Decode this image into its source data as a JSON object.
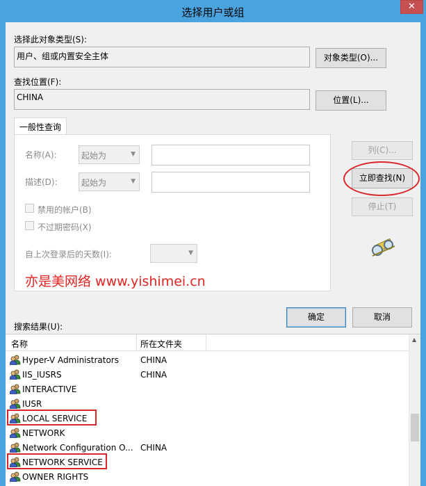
{
  "window": {
    "title": "选择用户或组",
    "close_glyph": "✕"
  },
  "object_type": {
    "label": "选择此对象类型(S):",
    "value": "用户、组或内置安全主体",
    "button": "对象类型(O)..."
  },
  "location": {
    "label": "查找位置(F):",
    "value": "CHINA",
    "button": "位置(L)..."
  },
  "query": {
    "tab_label": "一般性查询",
    "name_label": "名称(A):",
    "name_mode": "起始为",
    "desc_label": "描述(D):",
    "desc_mode": "起始为",
    "disabled_accounts": "禁用的帐户(B)",
    "non_expiring": "不过期密码(X)",
    "days_label": "自上次登录后的天数(I):"
  },
  "side_buttons": {
    "columns": "列(C)...",
    "find_now": "立即查找(N)",
    "stop": "停止(T)"
  },
  "watermark": "亦是美网络 www.yishimei.cn",
  "dialog_buttons": {
    "ok": "确定",
    "cancel": "取消"
  },
  "results": {
    "label": "搜索结果(U):",
    "columns": [
      "名称",
      "所在文件夹"
    ],
    "rows": [
      {
        "name": "Hyper-V Administrators",
        "folder": "CHINA",
        "highlight": false
      },
      {
        "name": "IIS_IUSRS",
        "folder": "CHINA",
        "highlight": false
      },
      {
        "name": "INTERACTIVE",
        "folder": "",
        "highlight": false
      },
      {
        "name": "IUSR",
        "folder": "",
        "highlight": false
      },
      {
        "name": "LOCAL SERVICE",
        "folder": "",
        "highlight": true
      },
      {
        "name": "NETWORK",
        "folder": "",
        "highlight": false
      },
      {
        "name": "Network Configuration O...",
        "folder": "CHINA",
        "highlight": false
      },
      {
        "name": "NETWORK SERVICE",
        "folder": "",
        "highlight": true
      },
      {
        "name": "OWNER RIGHTS",
        "folder": "",
        "highlight": false
      }
    ]
  },
  "colors": {
    "titlebar": "#4aa3df",
    "annotation_red": "#d9262a",
    "watermark_red": "#e32323"
  },
  "icons": {
    "row_icon": "user-group-icon",
    "search_icon": "binoculars-icon"
  }
}
